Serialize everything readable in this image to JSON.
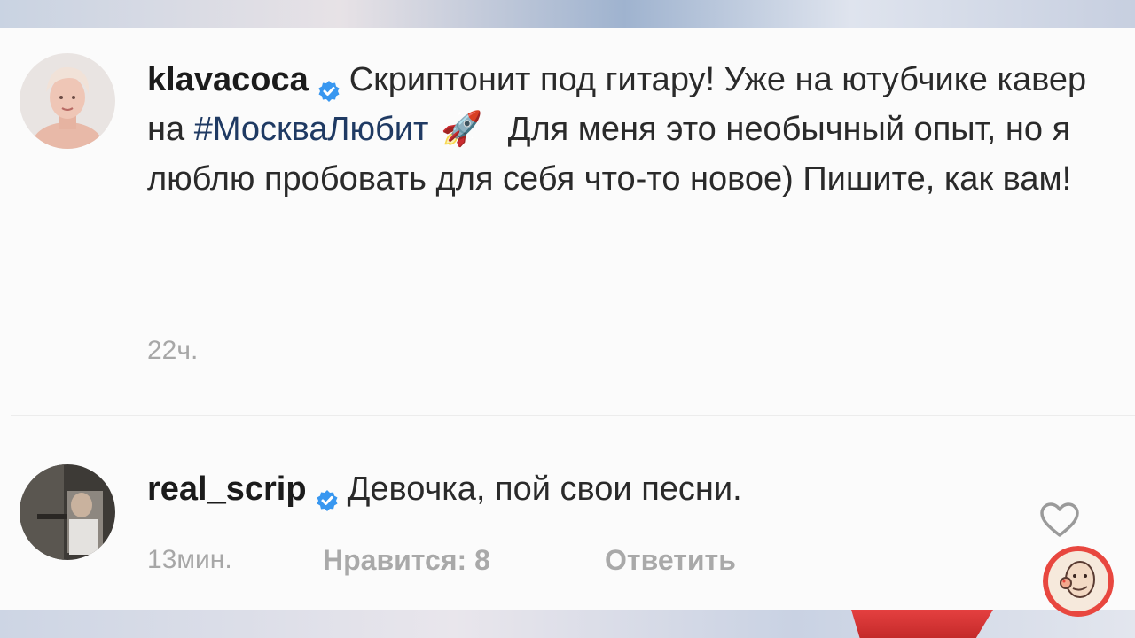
{
  "comments": [
    {
      "username": "klavacoca",
      "text_before": "Скриптонит под гитару! Уже на ютубчике кавер на ",
      "hashtag": "#МоскваЛюбит",
      "emoji": "🚀",
      "text_after": "Для меня это необычный опыт, но я люблю пробовать для себя что-то новое) Пишите, как вам!",
      "time": "22ч."
    },
    {
      "username": "real_scrip",
      "text": "Девочка, пой свои песни.",
      "time": "13мин.",
      "likes": "Нравится: 8",
      "reply": "Ответить"
    }
  ],
  "colors": {
    "verified": "#3897f0",
    "hashtag": "#1f3a63",
    "meta": "#a7a7a7"
  },
  "icons": {
    "verified": "verified-badge-icon",
    "like": "heart-icon",
    "rocket": "rocket-emoji-icon"
  }
}
